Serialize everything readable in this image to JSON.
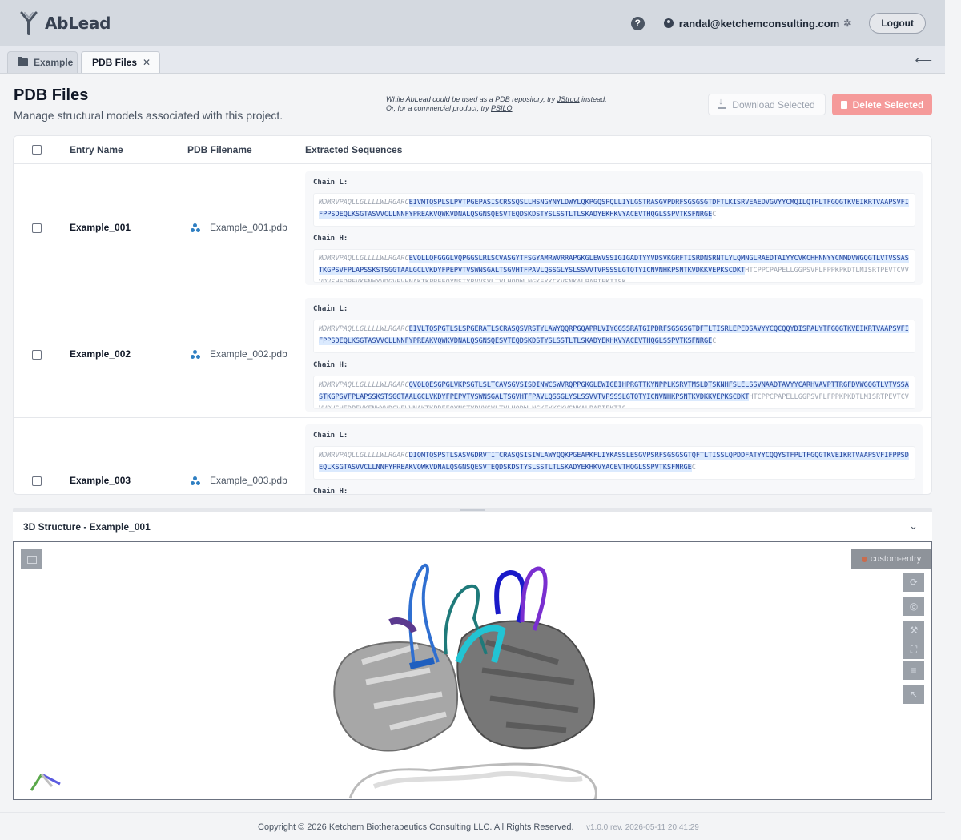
{
  "app": {
    "name": "AbLead",
    "user_email": "randal@ketchemconsulting.com",
    "logout_label": "Logout"
  },
  "tabs": [
    {
      "label": "Example",
      "icon": "folder-icon"
    },
    {
      "label": "PDB Files",
      "icon": "close-icon",
      "active": true
    }
  ],
  "header": {
    "title": "PDB Files",
    "subtitle": "Manage structural models associated with this project.",
    "note_line1_a": "While AbLead could be used as a PDB repository, try ",
    "note_link1": "JStruct",
    "note_line1_b": " instead.",
    "note_line2_a": "Or, for a commercial product, try ",
    "note_link2": "PSILO",
    "note_line2_b": ".",
    "download_label": "Download Selected",
    "delete_label": "Delete Selected"
  },
  "table": {
    "columns": [
      "Entry Name",
      "PDB Filename",
      "Extracted Sequences"
    ],
    "rows": [
      {
        "entry": "Example_001",
        "file": "Example_001.pdb",
        "chain_l_label": "Chain L:",
        "chain_l_sig": "MDMRVPAQLLGLLLLWLRGARC",
        "chain_l_var": "EIVMTQSPLSLPVTPGEPASISCRSSQSLLHSNGYNYLDWYLQKPGQSPQLLIYLGSTRASGVPDRFSGSGSGTDFTLKISRVEAEDVGVYYCMQILQTPLTFGQGTKVEIKRTVAAPSVFIFPPSDEQLKSGTASVVCLLNNFYPREAKVQWKVDNALQSGNSQESVTEQDSKDSTYSLSSTLTLSKADYEKHKVYACEVTHQGLSSPVTKSFNRGE",
        "chain_l_end": "C",
        "chain_h_label": "Chain H:",
        "chain_h_sig": "MDMRVPAQLLGLLLLWLRGARC",
        "chain_h_var": "EVQLLQFGGGLVQPGGSLRLSCVASGYTFSGYAMRWVRRAPGKGLEWVSSIGIGADTYYVDSVKGRFTISRDNSRNTLYLQMNGLRAEDTAIYYCVKCHHNNYYCNMDVWGQGTLVTVSSASTKGPSVFPLAPSSKSTSGGTAALGCLVKDYFPEPVTVSWNSGALTSGVHTFPAVLQSSGLYSLSSVVTVPSSSLGTQTYICNVNHKPSNTKVDKKVEPKSCDKT",
        "chain_h_end": "HTCPPCPAPELLGGPSVFLFPPKPKDTLMISRTPEVTCVVVDVSHEDPEVKFNWYVDGVEVHNAKTKPREEQYNSTYRVVSVLTVLHQDWLNGKEYKCKVSNKALPAPIEKTISK"
      },
      {
        "entry": "Example_002",
        "file": "Example_002.pdb",
        "chain_l_label": "Chain L:",
        "chain_l_sig": "MDMRVPAQLLGLLLLWLRGARC",
        "chain_l_var": "EIVLTQSPGTLSLSPGERATLSCRASQSVRSTYLAWYQQRPGQAPRLVIYGGSSRATGIPDRFSGSGSGTDFTLTISRLEPEDSAVYYCQCQQYDISPALYTFGQGTKVEIKRTVAAPSVFIFPPSDEQLKSGTASVVCLLNNFYPREAKVQWKVDNALQSGNSQESVTEQDSKDSTYSLSSTLTLSKADYEKHKVYACEVTHQGLSSPVTKSFNRGE",
        "chain_l_end": "C",
        "chain_h_label": "Chain H:",
        "chain_h_sig": "MDMRVPAQLLGLLLLWLRGARC",
        "chain_h_var": "QVQLQESGPGLVKPSGTLSLTCAVSGVSISDINWCSWVRQPPGKGLEWIGEIHPRGTTKYNPPLKSRVTMSLDTSKNHFSLELSSVNAADTAVYYCARHVAVPTTRGFDVWGQGTLVTVSSASTKGPSVFPLAPSSKSTSGGTAALGCLVKDYFPEPVTVSWNSGALTSGVHTFPAVLQSSGLYSLSSVVTVPSSSLGTQTYICNVNHKPSNTKVDKKVEPKSCDKT",
        "chain_h_end": "HTCPPCPAPELLGGPSVFLFPPKPKDTLMISRTPEVTCVVVDVSHEDPEVKFNWYVDGVEVHNAKTKPREEQYNSTYRVVSVLTVLHQDWLNGKEYKCKVSNKALPAPIEKTIS"
      },
      {
        "entry": "Example_003",
        "file": "Example_003.pdb",
        "chain_l_label": "Chain L:",
        "chain_l_sig": "MDMRVPAQLLGLLLLWLRGARC",
        "chain_l_var": "DIQMTQSPSTLSASVGDRVTITCRASQSISIWLAWYQQKPGEAPKFLIYKASSLESGVPSRFSGSGSGTQFTLTISSLQPDDFATYYCQQYSTFPLTFGQGTKVEIKRTVAAPSVFIFPPSDEQLKSGTASVVCLLNNFYPREAKVQWKVDNALQSGNSQESVTEQDSKDSTYSLSSTLTLSKADYEKHKVYACEVTHQGLSSPVTKSFNRGE",
        "chain_l_end": "C",
        "chain_h_label": "Chain H:"
      }
    ]
  },
  "structure": {
    "title": "3D Structure - Example_001",
    "entry_label": "custom-entry"
  },
  "footer": {
    "copyright": "Copyright © 2026 Ketchem Biotherapeutics Consulting LLC. All Rights Reserved.",
    "version": "v1.0.0 rev. 2026-05-11 20:41:29"
  },
  "colors": {
    "topbar": "#d4d9e0",
    "delete": "#f59a9a",
    "sequence_highlight": "#dbeafe"
  }
}
